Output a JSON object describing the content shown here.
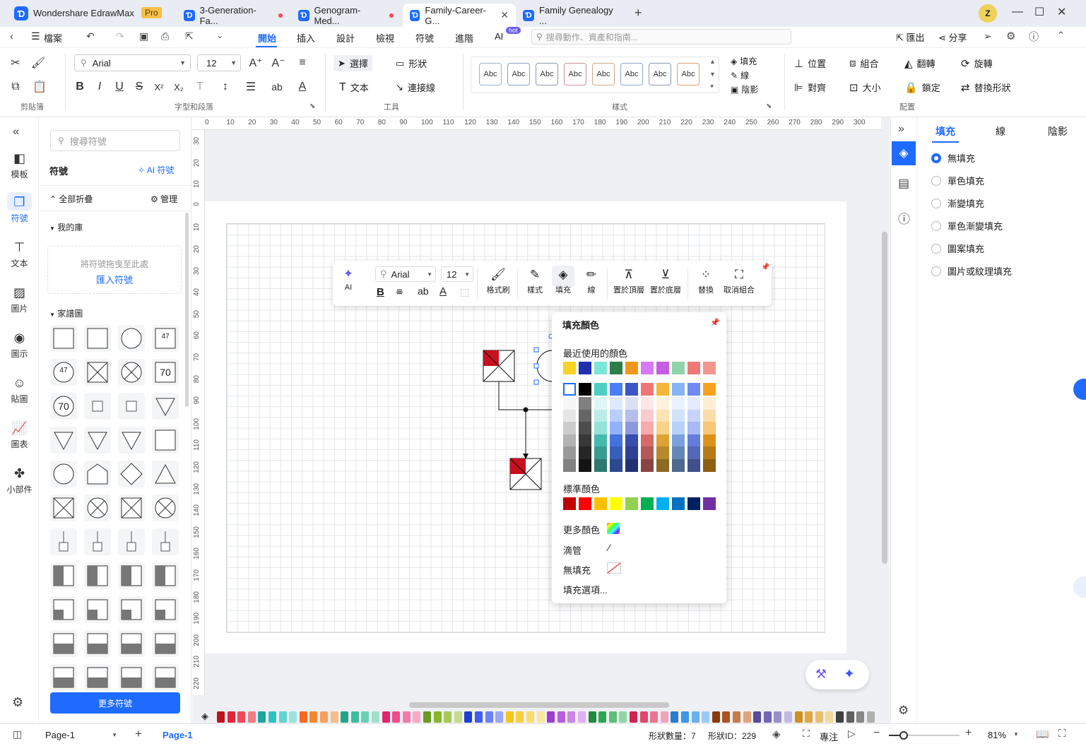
{
  "app": {
    "title": "Wondershare EdrawMax",
    "badge": "Pro",
    "user_initial": "Z"
  },
  "tabs": [
    {
      "label": "3-Generation-Fa...",
      "unsaved": true
    },
    {
      "label": "Genogram-Med...",
      "unsaved": true
    },
    {
      "label": "Family-Career-G...",
      "unsaved": false
    },
    {
      "label": "Family Genealogy ...",
      "unsaved": false
    }
  ],
  "menubar": {
    "file": "檔案",
    "items": [
      "開始",
      "插入",
      "設計",
      "檢視",
      "符號",
      "進階"
    ],
    "ai": "AI",
    "ai_badge": "hot",
    "search_placeholder": "搜尋動作、資產和指南...",
    "export": "匯出",
    "share": "分享"
  },
  "ribbon": {
    "font": "Arial",
    "size": "12",
    "select": "選擇",
    "shape": "形狀",
    "text": "文本",
    "connector": "連接線",
    "style_sample": "Abc",
    "fill": "填充",
    "line": "線",
    "shadow": "陰影",
    "position": "位置",
    "group": "組合",
    "flip": "翻轉",
    "rotate": "旋轉",
    "align": "對齊",
    "size_btn": "大小",
    "lock": "鎖定",
    "replace": "替換形狀",
    "groups": {
      "clipboard": "剪貼簿",
      "font": "字型和段落",
      "tools": "工具",
      "styles": "樣式",
      "arrange": "配置"
    }
  },
  "leftrail": [
    {
      "label": "模板",
      "icon": "template-icon"
    },
    {
      "label": "符號",
      "icon": "symbol-icon"
    },
    {
      "label": "文本",
      "icon": "text-icon"
    },
    {
      "label": "圖片",
      "icon": "image-icon"
    },
    {
      "label": "圖示",
      "icon": "icon-icon"
    },
    {
      "label": "貼圖",
      "icon": "sticker-icon"
    },
    {
      "label": "圖表",
      "icon": "chart-icon"
    },
    {
      "label": "小部件",
      "icon": "widget-icon"
    }
  ],
  "library": {
    "search_placeholder": "搜尋符號",
    "title": "符號",
    "ai_symbol": "AI 符號",
    "collapse_all": "全部折疊",
    "manage": "管理",
    "my_library": "我的庫",
    "drop_hint": "將符號拖曳至此處",
    "import": "匯入符號",
    "genogram": "家譜圖",
    "more": "更多符號",
    "shape_texts": [
      "47",
      "70"
    ]
  },
  "ruler": {
    "h": [
      "0",
      "10",
      "20",
      "30",
      "40",
      "50",
      "60",
      "70",
      "80",
      "90",
      "100",
      "110",
      "120",
      "130",
      "140",
      "150",
      "160",
      "170",
      "180",
      "190",
      "200",
      "210",
      "220",
      "230",
      "240",
      "250",
      "260",
      "270",
      "280",
      "290",
      "300"
    ],
    "v": [
      "30",
      "20",
      "10",
      "0",
      "10",
      "20",
      "30",
      "40",
      "50",
      "60",
      "70",
      "80",
      "90",
      "100",
      "110",
      "120",
      "130",
      "140",
      "150",
      "160",
      "170",
      "180",
      "190",
      "200",
      "210",
      "220"
    ]
  },
  "floating_toolbar": {
    "ai": "AI",
    "font": "Arial",
    "size": "12",
    "format_painter": "格式刷",
    "style": "樣式",
    "fill": "填充",
    "line": "線",
    "bring_front": "置於頂層",
    "send_back": "置於底層",
    "replace": "替換",
    "ungroup": "取消組合"
  },
  "fill_popup": {
    "title": "填充顏色",
    "recent": "最近使用的顏色",
    "recent_colors": [
      "#f5d327",
      "#1f2fb0",
      "#7ee6d8",
      "#2e7d4a",
      "#f0961e",
      "#d679f2",
      "#c55de0",
      "#8fd4a8",
      "#f07878",
      "#f4968e"
    ],
    "theme_top": [
      "#ffffff",
      "#000000",
      "#4dd0c0",
      "#4a7ef5",
      "#3d55c4",
      "#f07575",
      "#f5b53a",
      "#86b4f5",
      "#6f8af2",
      "#f5a21e"
    ],
    "standard": "標準顏色",
    "standard_colors": [
      "#c00000",
      "#ff0000",
      "#ffc000",
      "#ffff00",
      "#92d050",
      "#00b050",
      "#00b0f0",
      "#0070c0",
      "#002060",
      "#7030a0"
    ],
    "more": "更多顏色",
    "eyedropper": "滴管",
    "no_fill": "無填充",
    "options": "填充選項..."
  },
  "rightpanel": {
    "tabs": [
      "填充",
      "線",
      "陰影"
    ],
    "options": [
      "無填充",
      "單色填充",
      "漸變填充",
      "單色漸變填充",
      "圖案填充",
      "圖片或紋理填充"
    ],
    "selected": 0
  },
  "status": {
    "page_tab": "Page-1",
    "page_active": "Page-1",
    "shape_count": "形狀數量：7",
    "shape_id": "形狀ID：229",
    "focus": "專注",
    "zoom": "81%"
  },
  "accent": "#1f6bff"
}
